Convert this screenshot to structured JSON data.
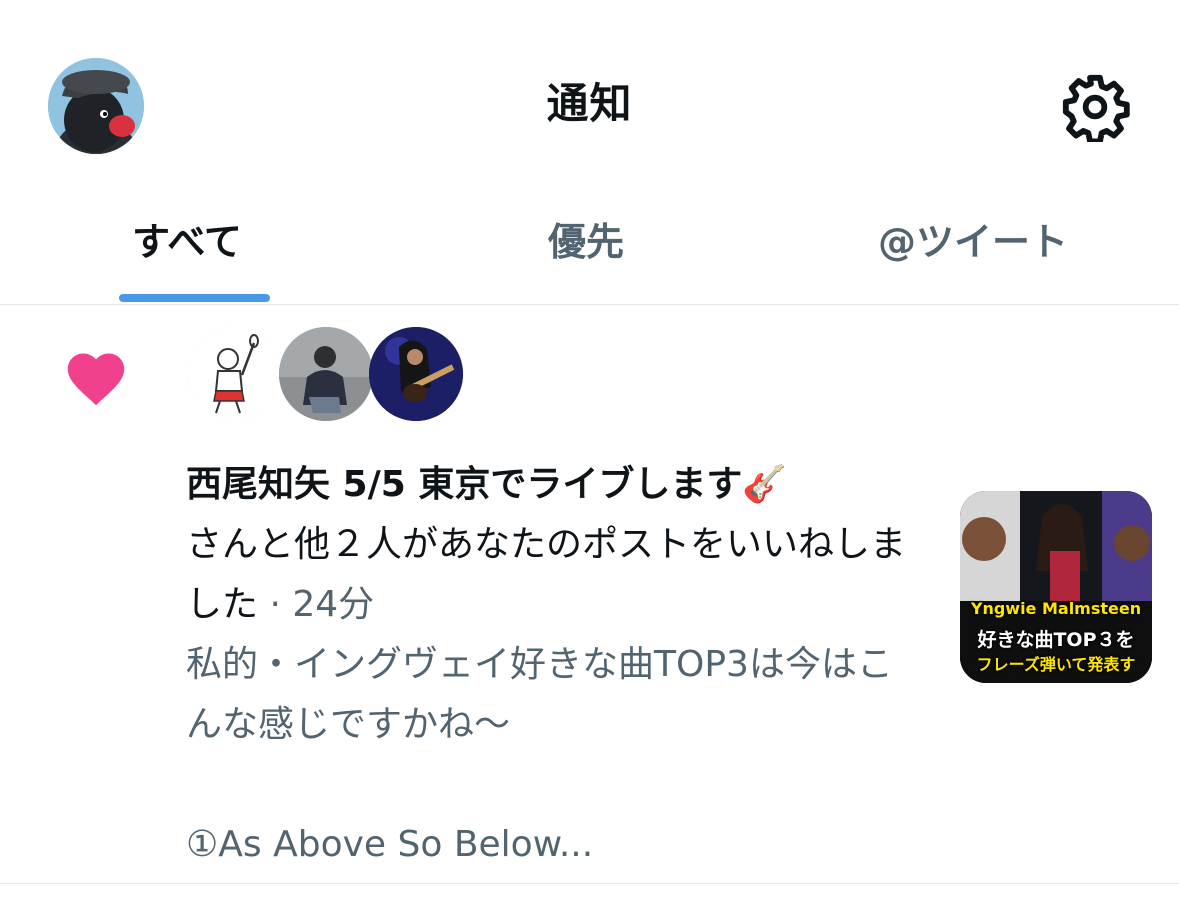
{
  "header": {
    "title": "通知",
    "avatar_icon": "user-avatar-penguin",
    "settings_icon": "gear-icon"
  },
  "tabs": [
    {
      "label": "すべて",
      "active": true
    },
    {
      "label": "優先",
      "active": false
    },
    {
      "label": "@ツイート",
      "active": false
    }
  ],
  "colors": {
    "accent": "#4a99e9",
    "like": "#f0418c",
    "secondary_text": "#536471"
  },
  "notification": {
    "type_icon": "heart-icon",
    "liker_count": 3,
    "actor_name": "西尾知矢 5/5 東京でライブします🎸",
    "action": "さんと他２人があなたのポストをいいねしました",
    "separator": " · ",
    "time": "24分",
    "preview": "私的・イングヴェイ好きな曲TOP3は今はこんな感じですかね〜\n\n①As Above So Below...",
    "thumbnail": {
      "line1": "Yngwie Malmsteen",
      "line2": "好きな曲TOP３を",
      "line3": "フレーズ弾いて発表す"
    }
  }
}
